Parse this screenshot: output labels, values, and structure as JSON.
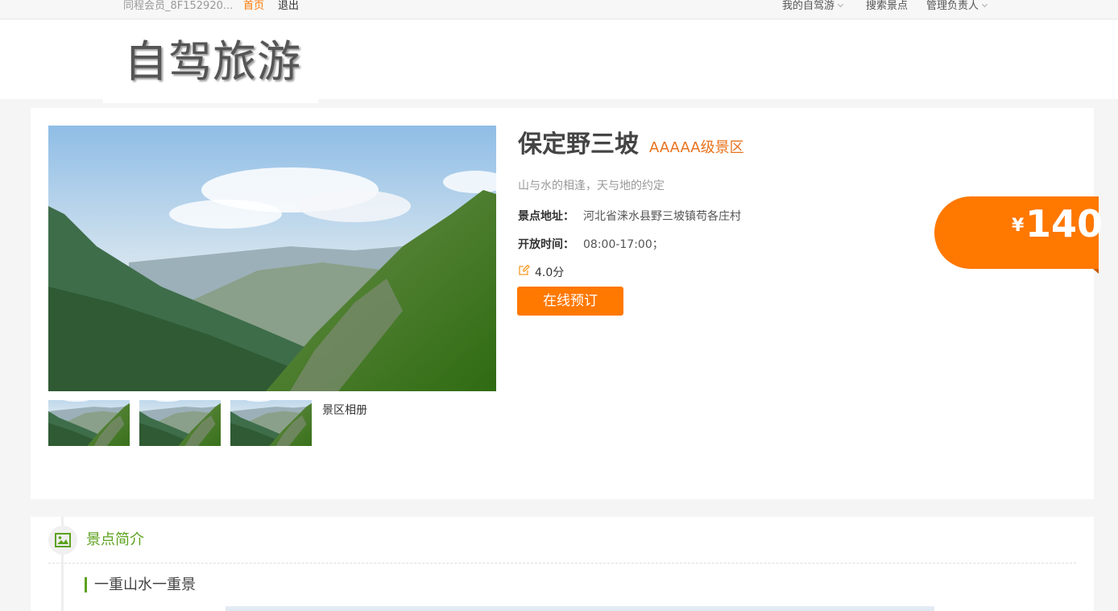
{
  "topbar": {
    "member": "同程会员_8F152920...",
    "home": "首页",
    "logout": "退出",
    "my_trips": "我的自驾游",
    "search_spots": "搜索景点",
    "manager": "管理负责人"
  },
  "header": {
    "logo_text": "自驾旅游"
  },
  "spot": {
    "name": "保定野三坡",
    "level": "AAAAA级景区",
    "slogan": "山与水的相逢，天与地的约定",
    "address_label": "景点地址：",
    "address": "河北省涞水县野三坡镇苟各庄村",
    "hours_label": "开放时间：",
    "hours": "08:00-17:00；",
    "score": "4.0分",
    "book_button": "在线预订",
    "price_currency": "¥",
    "price": "140",
    "gallery_link": "景区相册"
  },
  "intro": {
    "section_title": "景点简介",
    "subtitle": "一重山水一重景"
  },
  "colors": {
    "accent_orange": "#ff7800",
    "accent_green": "#5ba21c"
  }
}
